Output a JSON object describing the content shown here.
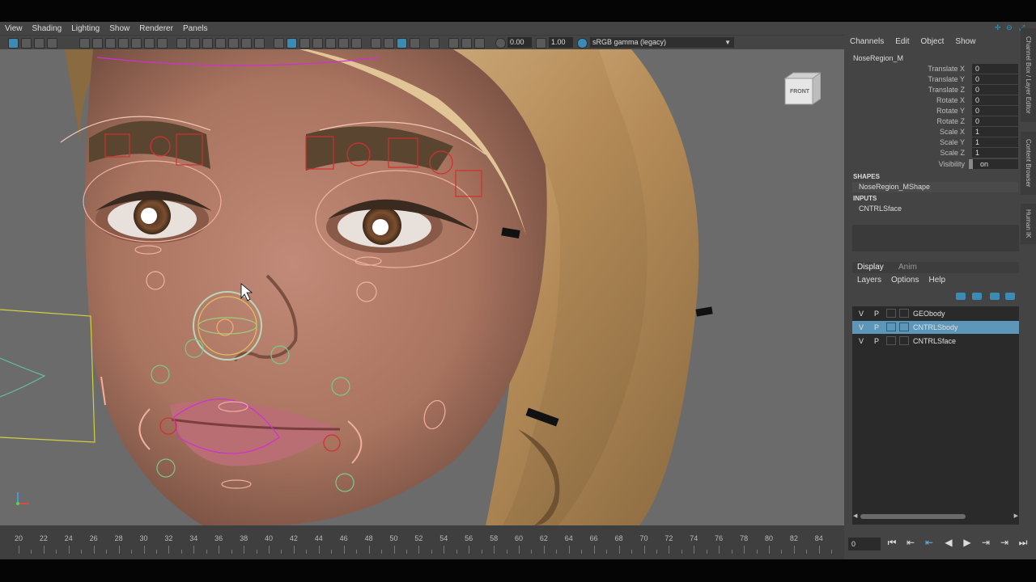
{
  "viewport": {
    "menu": [
      "View",
      "Shading",
      "Lighting",
      "Show",
      "Renderer",
      "Panels"
    ],
    "toolbar": {
      "exposure_value": "0.00",
      "gamma_value": "1.00",
      "color_space": "sRGB gamma (legacy)"
    },
    "viewcube_label": "FRONT"
  },
  "channel_box": {
    "menu": [
      "Channels",
      "Edit",
      "Object",
      "Show"
    ],
    "side_tabs": [
      "Channel Box / Layer Editor",
      "Content Browser",
      "Human IK"
    ],
    "object_name": "NoseRegion_M",
    "attributes": [
      {
        "label": "Translate X",
        "value": "0"
      },
      {
        "label": "Translate Y",
        "value": "0"
      },
      {
        "label": "Translate Z",
        "value": "0"
      },
      {
        "label": "Rotate X",
        "value": "0"
      },
      {
        "label": "Rotate Y",
        "value": "0"
      },
      {
        "label": "Rotate Z",
        "value": "0"
      },
      {
        "label": "Scale X",
        "value": "1"
      },
      {
        "label": "Scale Y",
        "value": "1"
      },
      {
        "label": "Scale Z",
        "value": "1"
      },
      {
        "label": "Visibility",
        "value": "on"
      }
    ],
    "shapes_header": "SHAPES",
    "shape_item": "NoseRegion_MShape",
    "inputs_header": "INPUTS",
    "input_item": "CNTRLSface"
  },
  "layer_editor": {
    "tabs": [
      "Display",
      "Anim"
    ],
    "menu": [
      "Layers",
      "Options",
      "Help"
    ],
    "layers": [
      {
        "v": "V",
        "p": "P",
        "name": "GEObody",
        "selected": false
      },
      {
        "v": "V",
        "p": "P",
        "name": "CNTRLSbody",
        "selected": true
      },
      {
        "v": "V",
        "p": "P",
        "name": "CNTRLSface",
        "selected": false
      }
    ]
  },
  "timeline": {
    "labels": [
      "20",
      "22",
      "24",
      "26",
      "28",
      "30",
      "32",
      "34",
      "36",
      "38",
      "40",
      "42",
      "44",
      "46",
      "48",
      "50",
      "52",
      "54",
      "56",
      "58",
      "60",
      "62",
      "64",
      "66",
      "68",
      "70",
      "72",
      "74",
      "76",
      "78",
      "80",
      "82",
      "84"
    ],
    "current_frame": "0"
  },
  "icons": {
    "playback": [
      "skip-to-start-icon",
      "step-back-key-icon",
      "step-back-frame-icon",
      "play-backward-icon",
      "play-forward-icon",
      "step-forward-frame-icon",
      "skip-to-end-icon"
    ]
  }
}
